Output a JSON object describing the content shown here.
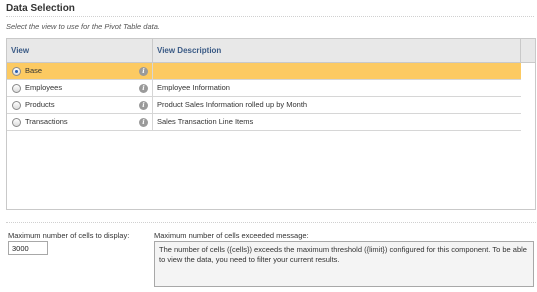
{
  "section": {
    "title": "Data Selection",
    "subtitle": "Select the view to use for the Pivot Table data."
  },
  "grid": {
    "columns": {
      "view": "View",
      "description": "View Description"
    },
    "rows": [
      {
        "view": "Base",
        "description": "",
        "selected": true,
        "info_icon": "info-icon"
      },
      {
        "view": "Employees",
        "description": "Employee Information",
        "selected": false,
        "info_icon": "info-icon"
      },
      {
        "view": "Products",
        "description": "Product Sales Information rolled up by Month",
        "selected": false,
        "info_icon": "info-icon"
      },
      {
        "view": "Transactions",
        "description": "Sales Transaction Line Items",
        "selected": false,
        "info_icon": "info-icon"
      }
    ],
    "selected_color": "#fcca62",
    "header_text_color": "#3a5a85"
  },
  "settings": {
    "max_cells_label": "Maximum number of cells to display:",
    "max_cells_value": "3000",
    "exceeded_label": "Maximum number of cells exceeded message:",
    "exceeded_message": "The number of cells ({cells}) exceeds the maximum threshold ({limit}) configured for this component. To be able to view the data, you need to filter your current results."
  }
}
